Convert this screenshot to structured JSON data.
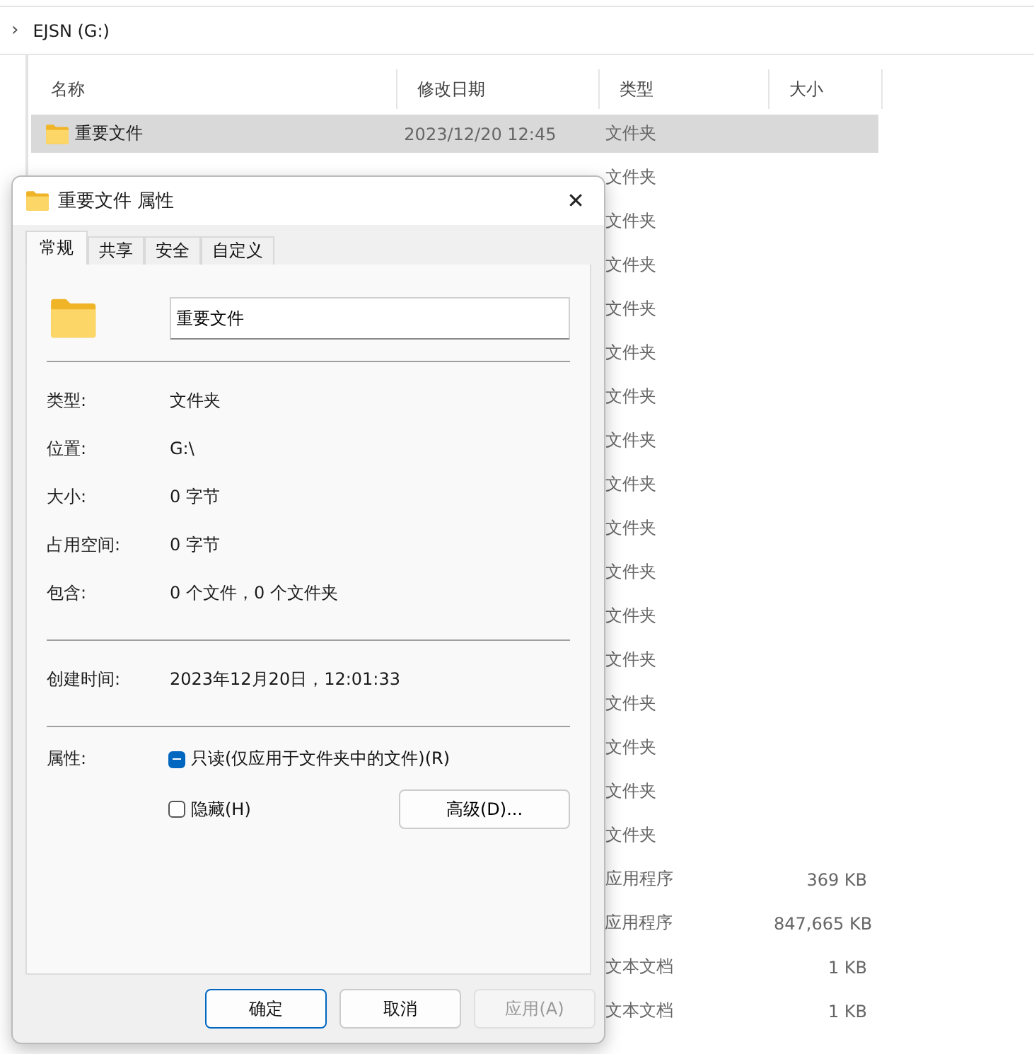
{
  "breadcrumb": {
    "caret": "›",
    "label": "EJSN (G:)"
  },
  "file_list": {
    "columns": [
      {
        "label": "名称"
      },
      {
        "label": "修改日期"
      },
      {
        "label": "类型"
      },
      {
        "label": "大小"
      }
    ],
    "rows": [
      {
        "name": "重要文件",
        "date": "2023/12/20 12:45",
        "type": "文件夹",
        "selected": true
      },
      {
        "type": "文件夹",
        "selected": false
      },
      {
        "type": "文件夹",
        "selected": false
      },
      {
        "type": "文件夹",
        "selected": false
      },
      {
        "type": "文件夹",
        "selected": false
      },
      {
        "type": "文件夹",
        "selected": false
      },
      {
        "type": "文件夹",
        "selected": false
      },
      {
        "type": "文件夹",
        "selected": false
      },
      {
        "type": "文件夹",
        "selected": false
      },
      {
        "type": "文件夹",
        "selected": false
      },
      {
        "type": "文件夹",
        "selected": false
      },
      {
        "type": "文件夹",
        "selected": false
      },
      {
        "type": "文件夹",
        "selected": false
      },
      {
        "type": "文件夹",
        "selected": false
      },
      {
        "type": "文件夹",
        "selected": false
      },
      {
        "type": "文件夹",
        "selected": false
      },
      {
        "type": "文件夹",
        "selected": false
      },
      {
        "type": "应用程序",
        "size": "369 KB",
        "selected": false
      },
      {
        "type": "应用程序",
        "size": "847,665 KB",
        "selected": false
      },
      {
        "type": "文本文档",
        "size": "1 KB",
        "selected": false
      },
      {
        "type": "文本文档",
        "size": "1 KB",
        "selected": false
      }
    ]
  },
  "dialog": {
    "title": "重要文件 属性",
    "close": "✕",
    "tabs": [
      {
        "label": "常规",
        "selected": true
      },
      {
        "label": "共享",
        "selected": false
      },
      {
        "label": "安全",
        "selected": false
      },
      {
        "label": "自定义",
        "selected": false
      }
    ],
    "name_field": {
      "value": "重要文件"
    },
    "groups": [
      [
        {
          "label": "类型:",
          "value": "文件夹"
        },
        {
          "label": "位置:",
          "value": "G:\\"
        },
        {
          "label": "大小:",
          "value": "0 字节"
        },
        {
          "label": "占用空间:",
          "value": "0 字节"
        },
        {
          "label": "包含:",
          "value": "0 个文件，0 个文件夹"
        }
      ],
      [
        {
          "label": "创建时间:",
          "value": "2023年12月20日，12:01:33"
        }
      ]
    ],
    "attributes": {
      "label": "属性:",
      "options": [
        {
          "label": "只读(仅应用于文件夹中的文件)(R)",
          "checked": true,
          "partial": true
        },
        {
          "label": "隐藏(H)",
          "checked": false,
          "partial": false
        }
      ],
      "advanced_button": "高级(D)..."
    },
    "buttons": [
      {
        "label": "确定",
        "kind": "default",
        "disabled": false
      },
      {
        "label": "取消",
        "kind": "normal",
        "disabled": false
      },
      {
        "label": "应用(A)",
        "kind": "normal",
        "disabled": true
      }
    ]
  }
}
